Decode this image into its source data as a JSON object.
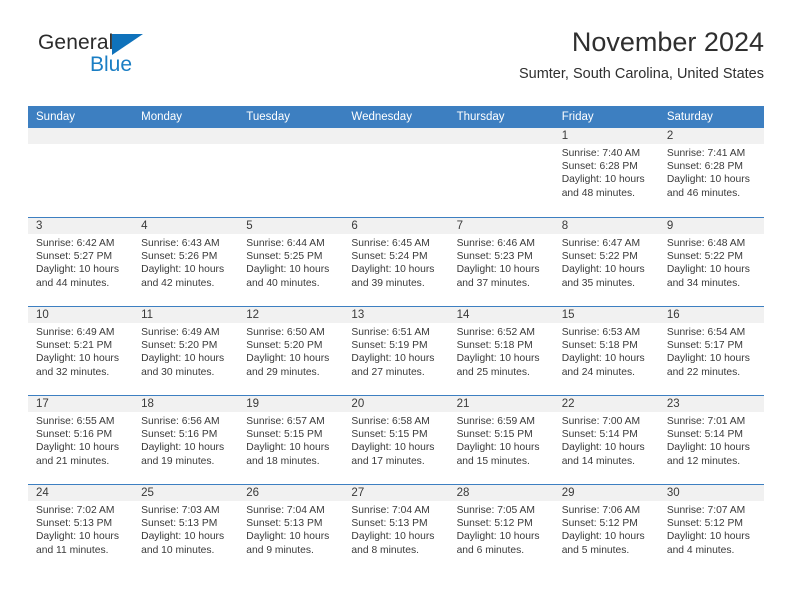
{
  "brand": {
    "name_top": "General",
    "name_bottom": "Blue",
    "accent_color": "#1a7ec4"
  },
  "header": {
    "title": "November 2024",
    "subtitle": "Sumter, South Carolina, United States"
  },
  "theme": {
    "header_blue": "#3d7fc1",
    "daynum_band": "#f1f1f1",
    "text": "#3a3a3a"
  },
  "weekdays": [
    "Sunday",
    "Monday",
    "Tuesday",
    "Wednesday",
    "Thursday",
    "Friday",
    "Saturday"
  ],
  "weeks": [
    [
      {
        "day": "",
        "sunrise": "",
        "sunset": "",
        "daylight": ""
      },
      {
        "day": "",
        "sunrise": "",
        "sunset": "",
        "daylight": ""
      },
      {
        "day": "",
        "sunrise": "",
        "sunset": "",
        "daylight": ""
      },
      {
        "day": "",
        "sunrise": "",
        "sunset": "",
        "daylight": ""
      },
      {
        "day": "",
        "sunrise": "",
        "sunset": "",
        "daylight": ""
      },
      {
        "day": "1",
        "sunrise": "Sunrise: 7:40 AM",
        "sunset": "Sunset: 6:28 PM",
        "daylight": "Daylight: 10 hours and 48 minutes."
      },
      {
        "day": "2",
        "sunrise": "Sunrise: 7:41 AM",
        "sunset": "Sunset: 6:28 PM",
        "daylight": "Daylight: 10 hours and 46 minutes."
      }
    ],
    [
      {
        "day": "3",
        "sunrise": "Sunrise: 6:42 AM",
        "sunset": "Sunset: 5:27 PM",
        "daylight": "Daylight: 10 hours and 44 minutes."
      },
      {
        "day": "4",
        "sunrise": "Sunrise: 6:43 AM",
        "sunset": "Sunset: 5:26 PM",
        "daylight": "Daylight: 10 hours and 42 minutes."
      },
      {
        "day": "5",
        "sunrise": "Sunrise: 6:44 AM",
        "sunset": "Sunset: 5:25 PM",
        "daylight": "Daylight: 10 hours and 40 minutes."
      },
      {
        "day": "6",
        "sunrise": "Sunrise: 6:45 AM",
        "sunset": "Sunset: 5:24 PM",
        "daylight": "Daylight: 10 hours and 39 minutes."
      },
      {
        "day": "7",
        "sunrise": "Sunrise: 6:46 AM",
        "sunset": "Sunset: 5:23 PM",
        "daylight": "Daylight: 10 hours and 37 minutes."
      },
      {
        "day": "8",
        "sunrise": "Sunrise: 6:47 AM",
        "sunset": "Sunset: 5:22 PM",
        "daylight": "Daylight: 10 hours and 35 minutes."
      },
      {
        "day": "9",
        "sunrise": "Sunrise: 6:48 AM",
        "sunset": "Sunset: 5:22 PM",
        "daylight": "Daylight: 10 hours and 34 minutes."
      }
    ],
    [
      {
        "day": "10",
        "sunrise": "Sunrise: 6:49 AM",
        "sunset": "Sunset: 5:21 PM",
        "daylight": "Daylight: 10 hours and 32 minutes."
      },
      {
        "day": "11",
        "sunrise": "Sunrise: 6:49 AM",
        "sunset": "Sunset: 5:20 PM",
        "daylight": "Daylight: 10 hours and 30 minutes."
      },
      {
        "day": "12",
        "sunrise": "Sunrise: 6:50 AM",
        "sunset": "Sunset: 5:20 PM",
        "daylight": "Daylight: 10 hours and 29 minutes."
      },
      {
        "day": "13",
        "sunrise": "Sunrise: 6:51 AM",
        "sunset": "Sunset: 5:19 PM",
        "daylight": "Daylight: 10 hours and 27 minutes."
      },
      {
        "day": "14",
        "sunrise": "Sunrise: 6:52 AM",
        "sunset": "Sunset: 5:18 PM",
        "daylight": "Daylight: 10 hours and 25 minutes."
      },
      {
        "day": "15",
        "sunrise": "Sunrise: 6:53 AM",
        "sunset": "Sunset: 5:18 PM",
        "daylight": "Daylight: 10 hours and 24 minutes."
      },
      {
        "day": "16",
        "sunrise": "Sunrise: 6:54 AM",
        "sunset": "Sunset: 5:17 PM",
        "daylight": "Daylight: 10 hours and 22 minutes."
      }
    ],
    [
      {
        "day": "17",
        "sunrise": "Sunrise: 6:55 AM",
        "sunset": "Sunset: 5:16 PM",
        "daylight": "Daylight: 10 hours and 21 minutes."
      },
      {
        "day": "18",
        "sunrise": "Sunrise: 6:56 AM",
        "sunset": "Sunset: 5:16 PM",
        "daylight": "Daylight: 10 hours and 19 minutes."
      },
      {
        "day": "19",
        "sunrise": "Sunrise: 6:57 AM",
        "sunset": "Sunset: 5:15 PM",
        "daylight": "Daylight: 10 hours and 18 minutes."
      },
      {
        "day": "20",
        "sunrise": "Sunrise: 6:58 AM",
        "sunset": "Sunset: 5:15 PM",
        "daylight": "Daylight: 10 hours and 17 minutes."
      },
      {
        "day": "21",
        "sunrise": "Sunrise: 6:59 AM",
        "sunset": "Sunset: 5:15 PM",
        "daylight": "Daylight: 10 hours and 15 minutes."
      },
      {
        "day": "22",
        "sunrise": "Sunrise: 7:00 AM",
        "sunset": "Sunset: 5:14 PM",
        "daylight": "Daylight: 10 hours and 14 minutes."
      },
      {
        "day": "23",
        "sunrise": "Sunrise: 7:01 AM",
        "sunset": "Sunset: 5:14 PM",
        "daylight": "Daylight: 10 hours and 12 minutes."
      }
    ],
    [
      {
        "day": "24",
        "sunrise": "Sunrise: 7:02 AM",
        "sunset": "Sunset: 5:13 PM",
        "daylight": "Daylight: 10 hours and 11 minutes."
      },
      {
        "day": "25",
        "sunrise": "Sunrise: 7:03 AM",
        "sunset": "Sunset: 5:13 PM",
        "daylight": "Daylight: 10 hours and 10 minutes."
      },
      {
        "day": "26",
        "sunrise": "Sunrise: 7:04 AM",
        "sunset": "Sunset: 5:13 PM",
        "daylight": "Daylight: 10 hours and 9 minutes."
      },
      {
        "day": "27",
        "sunrise": "Sunrise: 7:04 AM",
        "sunset": "Sunset: 5:13 PM",
        "daylight": "Daylight: 10 hours and 8 minutes."
      },
      {
        "day": "28",
        "sunrise": "Sunrise: 7:05 AM",
        "sunset": "Sunset: 5:12 PM",
        "daylight": "Daylight: 10 hours and 6 minutes."
      },
      {
        "day": "29",
        "sunrise": "Sunrise: 7:06 AM",
        "sunset": "Sunset: 5:12 PM",
        "daylight": "Daylight: 10 hours and 5 minutes."
      },
      {
        "day": "30",
        "sunrise": "Sunrise: 7:07 AM",
        "sunset": "Sunset: 5:12 PM",
        "daylight": "Daylight: 10 hours and 4 minutes."
      }
    ]
  ]
}
